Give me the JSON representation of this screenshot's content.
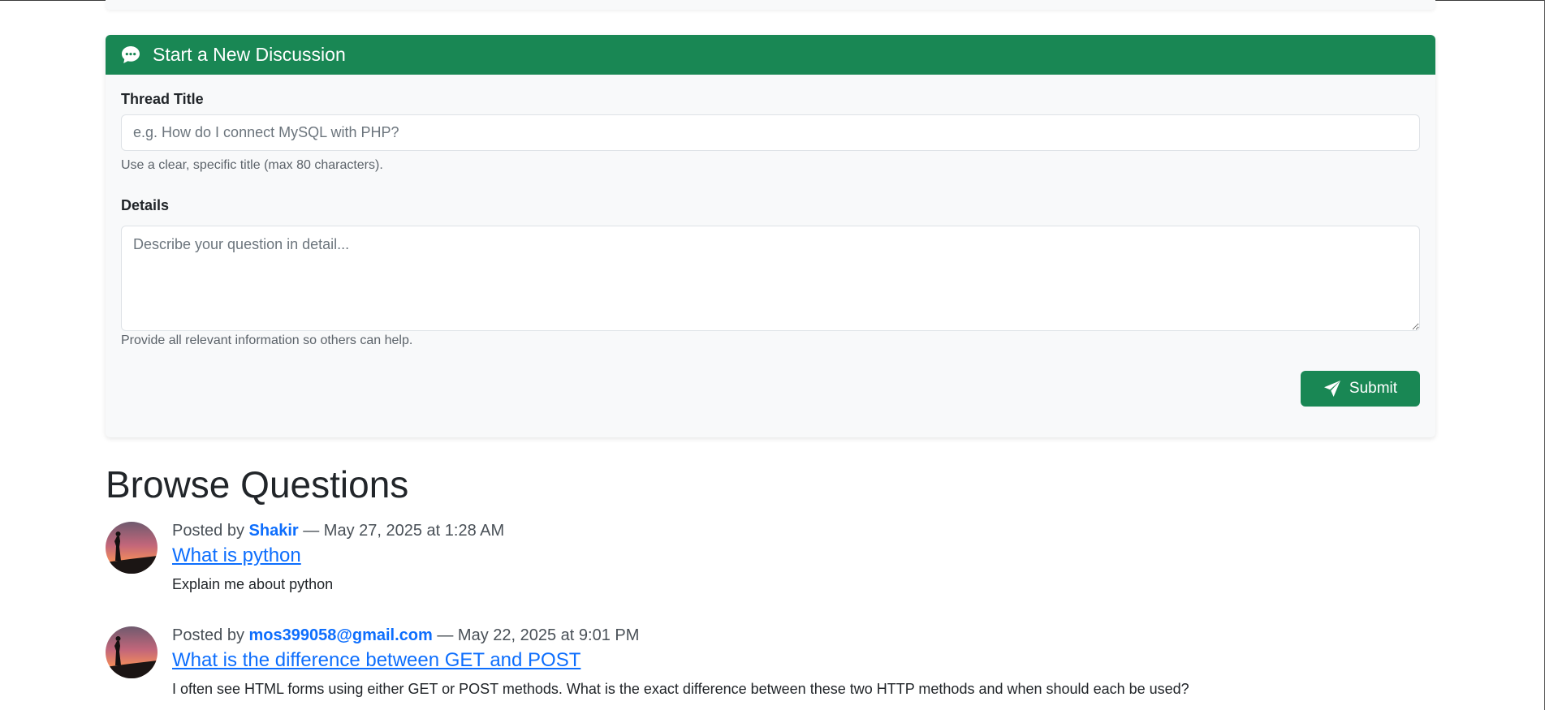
{
  "colors": {
    "primary_green": "#198754",
    "link_blue": "#0d6efd",
    "card_bg": "#f8f9fa"
  },
  "new_discussion": {
    "header_icon": "chat-bubble-icon",
    "header_title": "Start a New Discussion",
    "thread_title_label": "Thread Title",
    "thread_title_placeholder": "e.g. How do I connect MySQL with PHP?",
    "thread_title_value": "",
    "thread_title_help": "Use a clear, specific title (max 80 characters).",
    "details_label": "Details",
    "details_placeholder": "Describe your question in detail...",
    "details_value": "",
    "details_help": "Provide all relevant information so others can help.",
    "submit_icon": "send-icon",
    "submit_label": "Submit"
  },
  "browse": {
    "heading": "Browse Questions",
    "questions": [
      {
        "posted_by_prefix": "Posted by",
        "author": "Shakir",
        "date_text": "— May 27, 2025 at 1:28 AM",
        "title": "What is python",
        "description": "Explain me about python"
      },
      {
        "posted_by_prefix": "Posted by",
        "author": "mos399058@gmail.com",
        "date_text": "— May 22, 2025 at 9:01 PM",
        "title": "What is the difference between GET and POST",
        "description": "I often see HTML forms using either GET or POST methods. What is the exact difference between these two HTTP methods and when should each be used?"
      }
    ]
  }
}
